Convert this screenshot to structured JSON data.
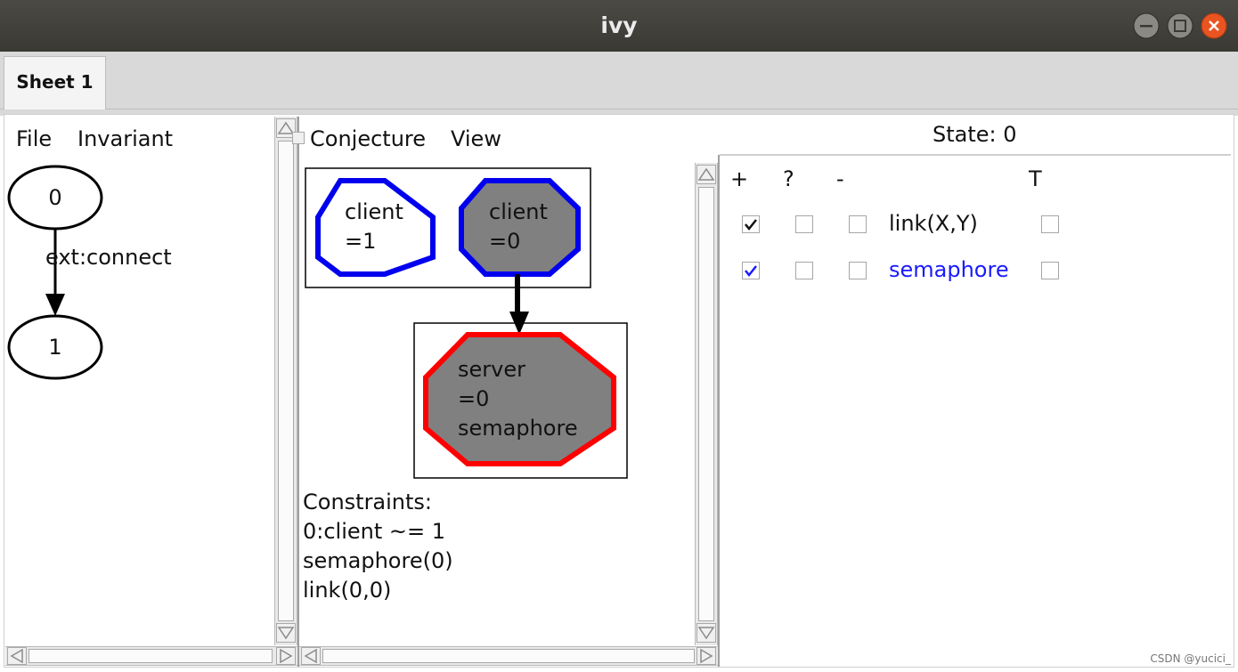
{
  "window": {
    "title": "ivy"
  },
  "tabs": [
    {
      "label": "Sheet 1"
    }
  ],
  "left_panel": {
    "menu": [
      "File",
      "Invariant"
    ],
    "graph": {
      "nodes": [
        "0",
        "1"
      ],
      "edge_label": "ext:connect"
    }
  },
  "middle_panel": {
    "menu": [
      "Conjecture",
      "View"
    ],
    "nodes": {
      "client1": [
        "client",
        "=1"
      ],
      "client0": [
        "client",
        "=0"
      ],
      "server": [
        "server",
        "=0",
        "semaphore"
      ]
    },
    "constraints": {
      "title": "Constraints:",
      "lines": [
        "0:client ~= 1",
        "semaphore(0)",
        "link(0,0)"
      ]
    }
  },
  "right_panel": {
    "state_label": "State: 0",
    "headers": {
      "plus": "+",
      "question": "?",
      "minus": "-",
      "t": "T"
    },
    "rows": [
      {
        "label": "link(X,Y)",
        "plus_checked": true,
        "color": "#111111"
      },
      {
        "label": "semaphore",
        "plus_checked": true,
        "color": "#1a1aff"
      }
    ]
  },
  "colors": {
    "client_border": "#0000ee",
    "server_border": "#ff0000",
    "node_fill": "#808080"
  },
  "watermark": "CSDN @yucici_"
}
